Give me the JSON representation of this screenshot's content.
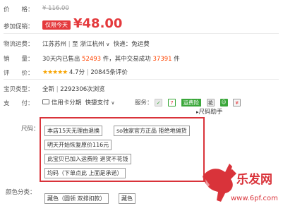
{
  "price": {
    "label": "价　　格：",
    "original": "¥ 116.00"
  },
  "promo": {
    "label": "参加促销：",
    "tag": "仅限今天",
    "price": "¥48.00"
  },
  "shipping": {
    "label": "物流运费：",
    "from": "江苏苏州",
    "sep": "|",
    "to_prefix": "至",
    "to": "浙江杭州",
    "chevron": "∨",
    "fee": "快递：免运费"
  },
  "sales": {
    "label": "销　　量：",
    "prefix": "30天内已售出",
    "sold": "52493",
    "mid": "件，其中交易成功",
    "success": "37391",
    "suffix": "件"
  },
  "rating": {
    "label": "评　　价：",
    "stars": "★★★★★",
    "score": "4.7分",
    "sep": "|",
    "count": "20845条评价"
  },
  "item_type": {
    "label": "宝贝类型：",
    "value": "全新",
    "sep": "|",
    "views": "2292306次浏览"
  },
  "payment": {
    "label": "支　　付：",
    "credit": "信用卡分期",
    "fast": "快捷支付",
    "chevron": "∨"
  },
  "service": {
    "label": "服务：",
    "insurance_tag": "运费险"
  },
  "size_helper": "尺码助手",
  "size": {
    "label": "尺码：",
    "options": [
      "本店15天无理由退换",
      "so独家官方正品 拒绝地摊货",
      "明天开始恢复原价116元",
      "此宝贝已加入运费险 退货不花钱",
      "均码（下单点此 上面是承诺）"
    ]
  },
  "color": {
    "label": "颜色分类：",
    "options": [
      "藏色（圆领 双排扣款）",
      "藏色"
    ]
  },
  "watermark": {
    "brand": "乐发网",
    "url": "www.6pf.com"
  },
  "colors": {
    "accent": "#e4393c",
    "orange": "#ff4400",
    "star": "#f7a400",
    "tmall": "#e4393c",
    "green": "#3aa73a"
  }
}
